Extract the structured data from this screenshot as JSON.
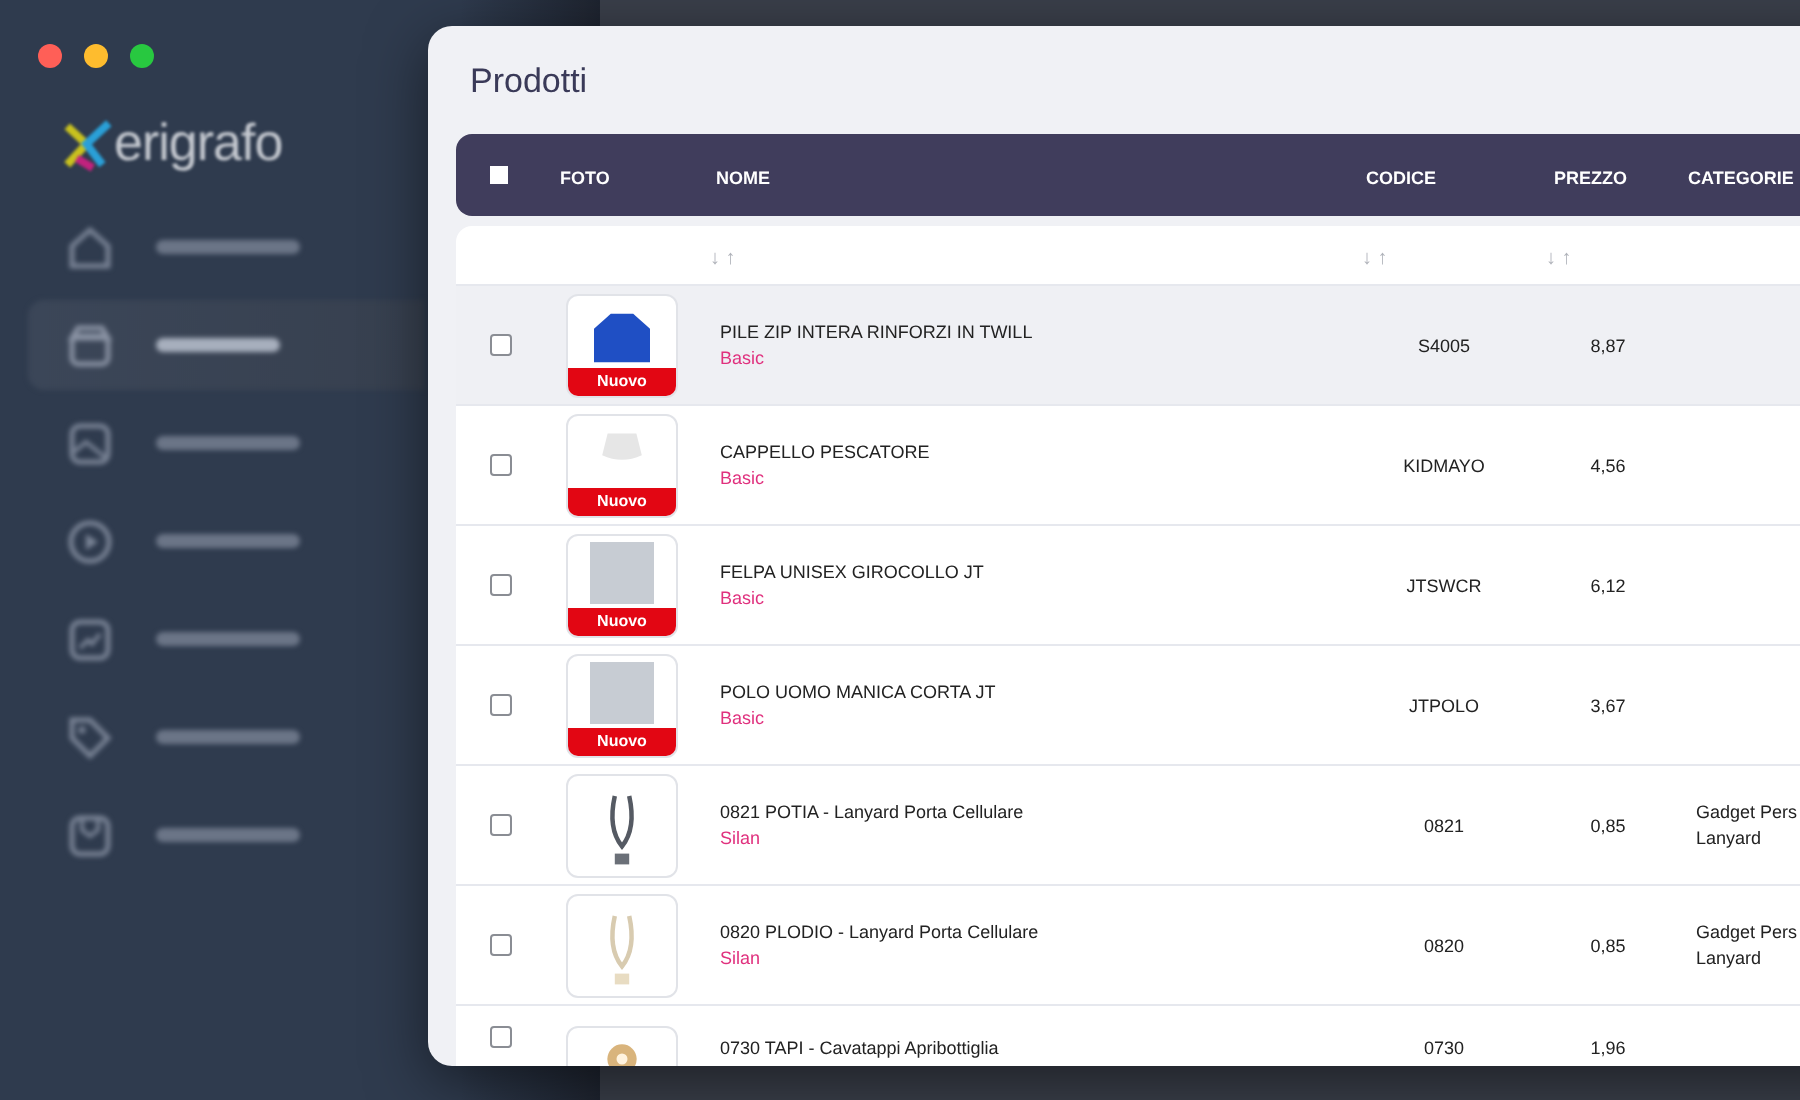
{
  "window_controls": [
    {
      "color": "#ff5f57"
    },
    {
      "color": "#febc2e"
    },
    {
      "color": "#28c840"
    }
  ],
  "sidebar": {
    "logo": "erigrafo",
    "items": [
      {
        "kind": "home",
        "selected": false
      },
      {
        "kind": "store",
        "selected": true
      },
      {
        "kind": "image",
        "selected": false
      },
      {
        "kind": "play",
        "selected": false
      },
      {
        "kind": "chart",
        "selected": false
      },
      {
        "kind": "tag",
        "selected": false
      },
      {
        "kind": "box",
        "selected": false
      }
    ]
  },
  "window": {
    "title": "Prodotti"
  },
  "table": {
    "select_all": {
      "checked": false
    },
    "columns": [
      {
        "label": "FOTO"
      },
      {
        "label": "NOME",
        "sort": "↓ ↑"
      },
      {
        "label": "CODICE",
        "sort": "↓ ↑"
      },
      {
        "label": "PREZZO",
        "sort": "↓ ↑"
      },
      {
        "label": "CATEGORIE"
      }
    ],
    "rows": [
      {
        "hovered": true,
        "checked": false,
        "photo": {
          "kind": "jacket",
          "badge": "Nuovo"
        },
        "name": "PILE ZIP INTERA RINFORZI IN TWILL",
        "brand": "Basic",
        "code": "S4005",
        "price": "8,87"
      },
      {
        "hovered": false,
        "checked": false,
        "photo": {
          "kind": "hat",
          "badge": "Nuovo"
        },
        "name": "CAPPELLO PESCATORE",
        "brand": "Basic",
        "code": "KIDMAYO",
        "price": "4,56"
      },
      {
        "hovered": false,
        "checked": false,
        "photo": {
          "kind": "photo",
          "badge": "Nuovo"
        },
        "name": "FELPA UNISEX GIROCOLLO JT",
        "brand": "Basic",
        "code": "JTSWCR",
        "price": "6,12"
      },
      {
        "hovered": false,
        "checked": false,
        "photo": {
          "kind": "photo",
          "badge": "Nuovo"
        },
        "name": "POLO UOMO MANICA CORTA JT",
        "brand": "Basic",
        "code": "JTPOLO",
        "price": "3,67"
      },
      {
        "hovered": false,
        "checked": false,
        "photo": {
          "kind": "lanyard-dark"
        },
        "name": "0821 POTIA - Lanyard Porta Cellulare",
        "brand": "Silan",
        "code": "0821",
        "price": "0,85",
        "categories": [
          "Gadget Pers",
          "Lanyard"
        ]
      },
      {
        "hovered": false,
        "checked": false,
        "photo": {
          "kind": "lanyard-light"
        },
        "name": "0820 PLODIO - Lanyard Porta Cellulare",
        "brand": "Silan",
        "code": "0820",
        "price": "0,85",
        "categories": [
          "Gadget Pers",
          "Lanyard"
        ]
      },
      {
        "hovered": false,
        "checked": false,
        "photo": {
          "kind": "opener"
        },
        "name": "0730 TAPI - Cavatappi Apribottiglia",
        "code": "0730",
        "price": "1,96"
      }
    ]
  }
}
